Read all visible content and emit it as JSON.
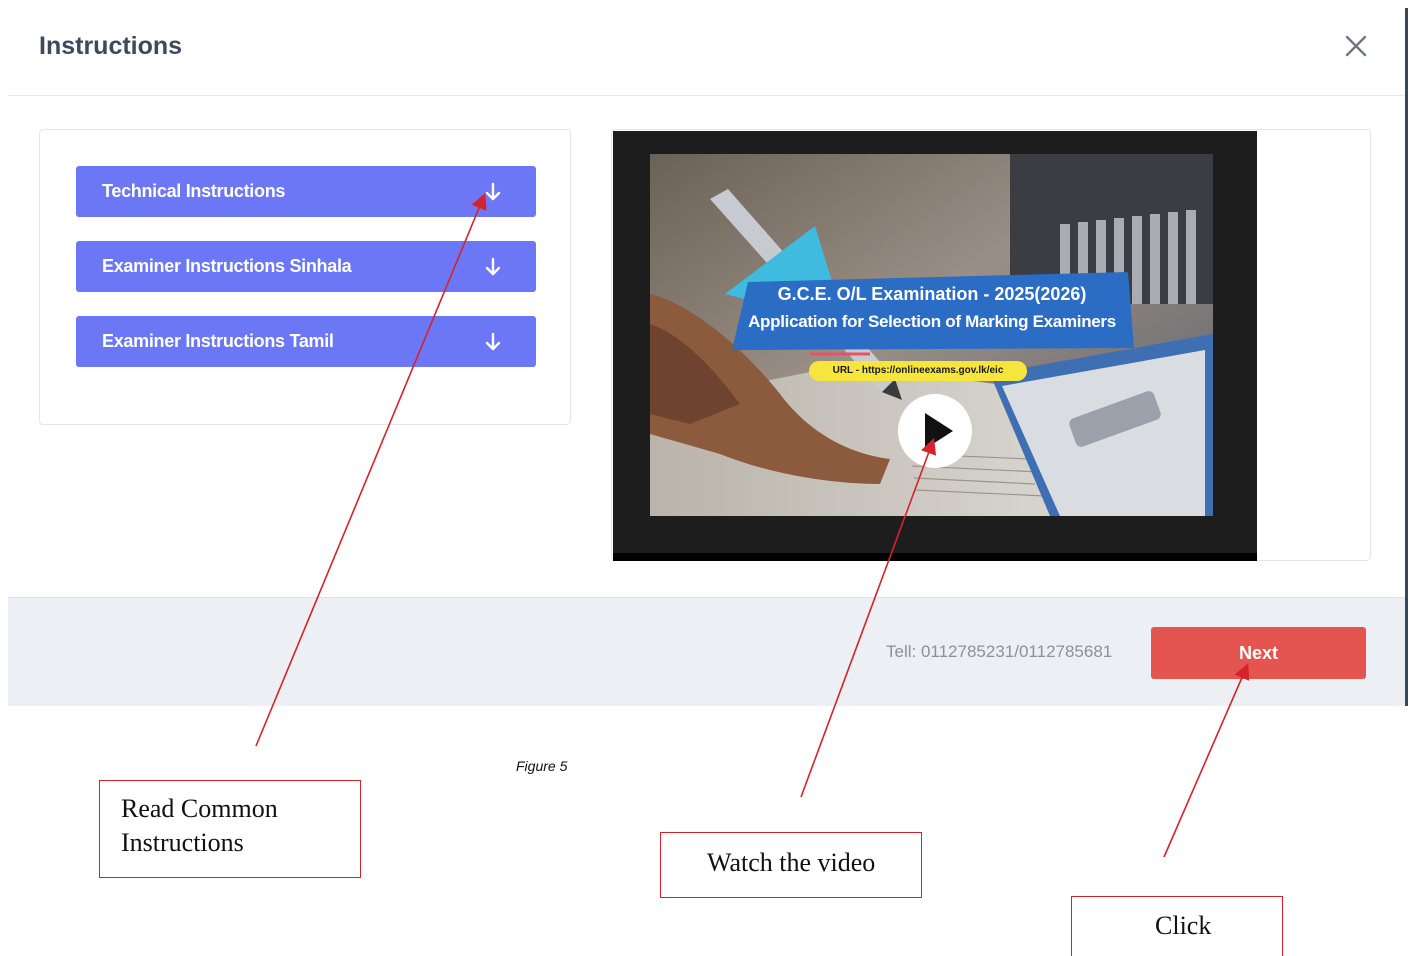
{
  "modal": {
    "title": "Instructions",
    "close_icon": "close-icon"
  },
  "instructions": {
    "items": [
      {
        "label": "Technical Instructions",
        "icon": "arrow-down-icon"
      },
      {
        "label": "Examiner Instructions Sinhala",
        "icon": "arrow-down-icon"
      },
      {
        "label": "Examiner Instructions Tamil",
        "icon": "arrow-down-icon"
      }
    ]
  },
  "video": {
    "line1": "G.C.E. O/L Examination - 2025(2026)",
    "line2": "Application for Selection of Marking Examiners",
    "url_label": "URL - https://onlineexams.gov.lk/eic",
    "play_icon": "play-icon"
  },
  "footer": {
    "tell": "Tell: 0112785231/0112785681",
    "next_label": "Next"
  },
  "document": {
    "figure_caption": "Figure 5",
    "callouts": {
      "read_line1": "Read Common",
      "read_line2": "Instructions",
      "watch": "Watch the video",
      "click": "Click"
    }
  },
  "colors": {
    "instruction_button": "#6b77f5",
    "next_button": "#e4554f",
    "annotation": "#d6222a",
    "banner": "#2b6cc4",
    "url_pill": "#f5e53c"
  }
}
